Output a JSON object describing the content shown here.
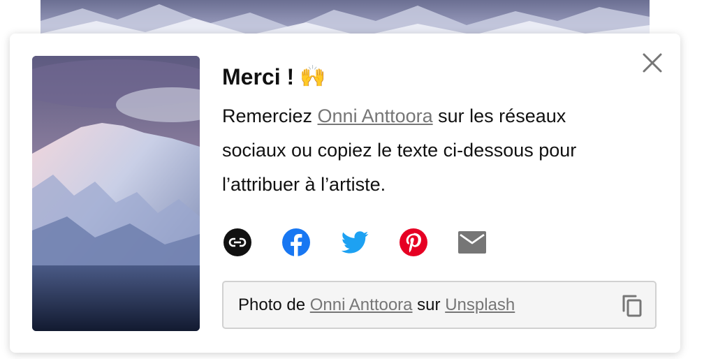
{
  "dialog": {
    "title": "Merci !",
    "title_emoji": "🙌",
    "message_before": "Remerciez ",
    "artist_name": "Onni Anttoora",
    "message_after": " sur les réseaux sociaux ou copiez le texte ci-dessous pour l’attribuer à l’artiste.",
    "close_icon": "close-icon"
  },
  "share": {
    "icons": [
      "link-icon",
      "facebook-icon",
      "twitter-icon",
      "pinterest-icon",
      "email-icon"
    ],
    "colors": {
      "link": "#111111",
      "facebook": "#1877f2",
      "twitter": "#1da1f2",
      "pinterest": "#e60023",
      "email": "#767676"
    }
  },
  "attribution": {
    "prefix": "Photo de ",
    "artist_name": "Onni Anttoora",
    "middle": " sur ",
    "platform": "Unsplash",
    "copy_icon": "copy-icon"
  }
}
